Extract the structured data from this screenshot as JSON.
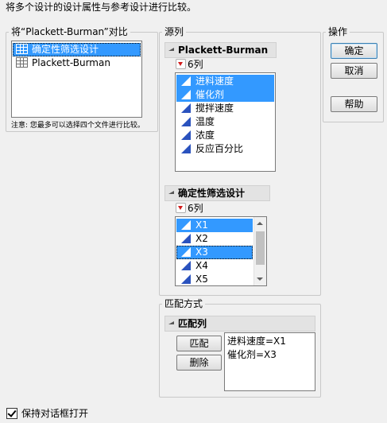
{
  "instruction": "将多个设计的设计属性与参考设计进行比较。",
  "compare_box": {
    "legend": "将“Plackett-Burman”对比",
    "items": [
      {
        "label": "确定性筛选设计",
        "selected": true
      },
      {
        "label": "Plackett-Burman",
        "selected": false
      }
    ],
    "note": "注意: 您最多可以选择四个文件进行比较。"
  },
  "source_cols": {
    "legend": "源列",
    "table1": {
      "title": "Plackett-Burman",
      "count": "6列",
      "columns": [
        {
          "label": "进料速度",
          "selected": true
        },
        {
          "label": "催化剂",
          "selected": true
        },
        {
          "label": "搅拌速度",
          "selected": false
        },
        {
          "label": "温度",
          "selected": false
        },
        {
          "label": "浓度",
          "selected": false
        },
        {
          "label": "反应百分比",
          "selected": false
        }
      ]
    },
    "table2": {
      "title": "确定性筛选设计",
      "count": "6列",
      "columns": [
        {
          "label": "X1",
          "selected": true
        },
        {
          "label": "X2",
          "selected": false
        },
        {
          "label": "X3",
          "selected": true
        },
        {
          "label": "X4",
          "selected": false
        },
        {
          "label": "X5",
          "selected": false
        }
      ]
    }
  },
  "actions": {
    "legend": "操作",
    "ok": "确定",
    "cancel": "取消",
    "help": "帮助"
  },
  "match": {
    "legend": "匹配方式",
    "header": "匹配列",
    "match_button": "匹配",
    "remove_button": "删除",
    "pairs": [
      "进料速度=X1",
      "催化剂=X3"
    ]
  },
  "keep_open": {
    "label": "保持对话框打开",
    "checked": true
  },
  "colors": {
    "selection": "#3399ff",
    "column_icon": "#2a52be",
    "red_arrow": "#d21c1c"
  }
}
